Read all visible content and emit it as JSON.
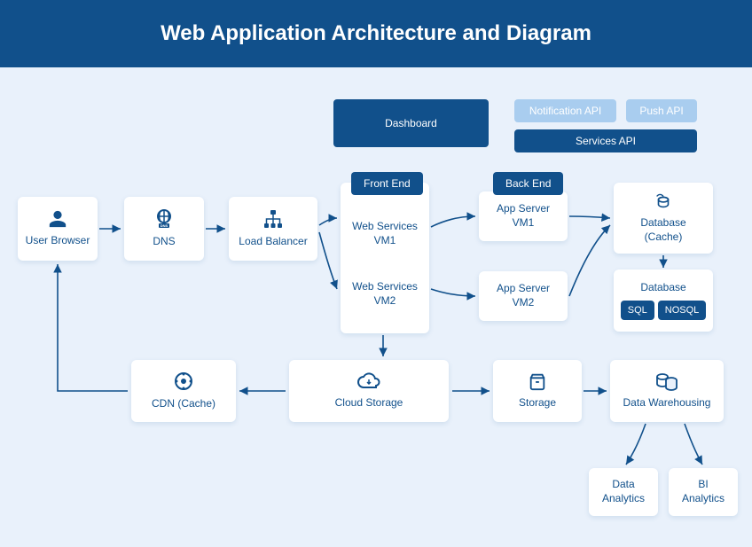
{
  "header": {
    "title": "Web Application Architecture and Diagram"
  },
  "pills": {
    "dashboard": "Dashboard",
    "notification_api": "Notification API",
    "push_api": "Push API",
    "services_api": "Services API"
  },
  "badges": {
    "front_end": "Front End",
    "back_end": "Back End"
  },
  "nodes": {
    "user_browser": "User Browser",
    "dns": "DNS",
    "load_balancer": "Load Balancer",
    "web_services_vm1": "Web Services VM1",
    "web_services_vm2": "Web Services VM2",
    "app_server_vm1": "App Server VM1",
    "app_server_vm2": "App Server VM2",
    "database_cache": "Database (Cache)",
    "database": "Database",
    "sql": "SQL",
    "nosql": "NOSQL",
    "cdn_cache": "CDN (Cache)",
    "cloud_storage": "Cloud Storage",
    "storage": "Storage",
    "data_warehousing": "Data Warehousing",
    "data_analytics": "Data Analytics",
    "bi_analytics": "BI Analytics"
  }
}
